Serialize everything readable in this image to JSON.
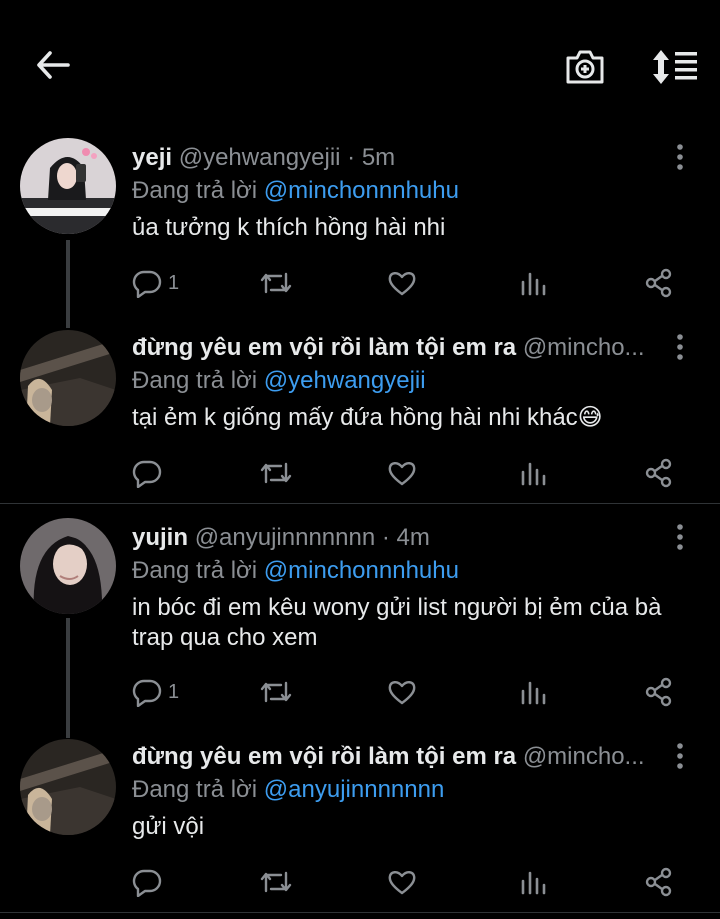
{
  "header": {
    "back_icon": "arrow-left-icon",
    "camera_icon": "camera-plus-icon",
    "sort_icon": "sort-list-icon"
  },
  "tweets": [
    {
      "name": "yeji",
      "handle": "@yehwangyejii",
      "dot": "·",
      "time": "5m",
      "replying_prefix": "Đang trả lời",
      "replying_to": "@minchonnnhuhu",
      "text": "ủa tưởng k thích hồng hài nhi",
      "reply_count": "1"
    },
    {
      "name": "đừng yêu em vội rồi làm tội em ra",
      "handle": "@mincho...",
      "dot": "",
      "time": "",
      "replying_prefix": "Đang trả lời",
      "replying_to": "@yehwangyejii",
      "text": "tại ẻm k giống mấy đứa hồng hài nhi khác😅",
      "reply_count": ""
    },
    {
      "name": "yujin",
      "handle": "@anyujinnnnnnn",
      "dot": "·",
      "time": "4m",
      "replying_prefix": "Đang trả lời",
      "replying_to": "@minchonnnhuhu",
      "text": "in bóc đi em kêu wony gửi list người bị ẻm của bà trap qua cho xem",
      "reply_count": "1"
    },
    {
      "name": "đừng yêu em vội rồi làm tội em ra",
      "handle": "@mincho...",
      "dot": "",
      "time": "",
      "replying_prefix": "Đang trả lời",
      "replying_to": "@anyujinnnnnnn",
      "text": "gửi vội",
      "reply_count": ""
    }
  ],
  "icons": {
    "reply": "reply-bubble-icon",
    "retweet": "retweet-icon",
    "like": "heart-icon",
    "stats": "bar-chart-icon",
    "share": "share-icon",
    "more": "more-vertical-icon"
  }
}
